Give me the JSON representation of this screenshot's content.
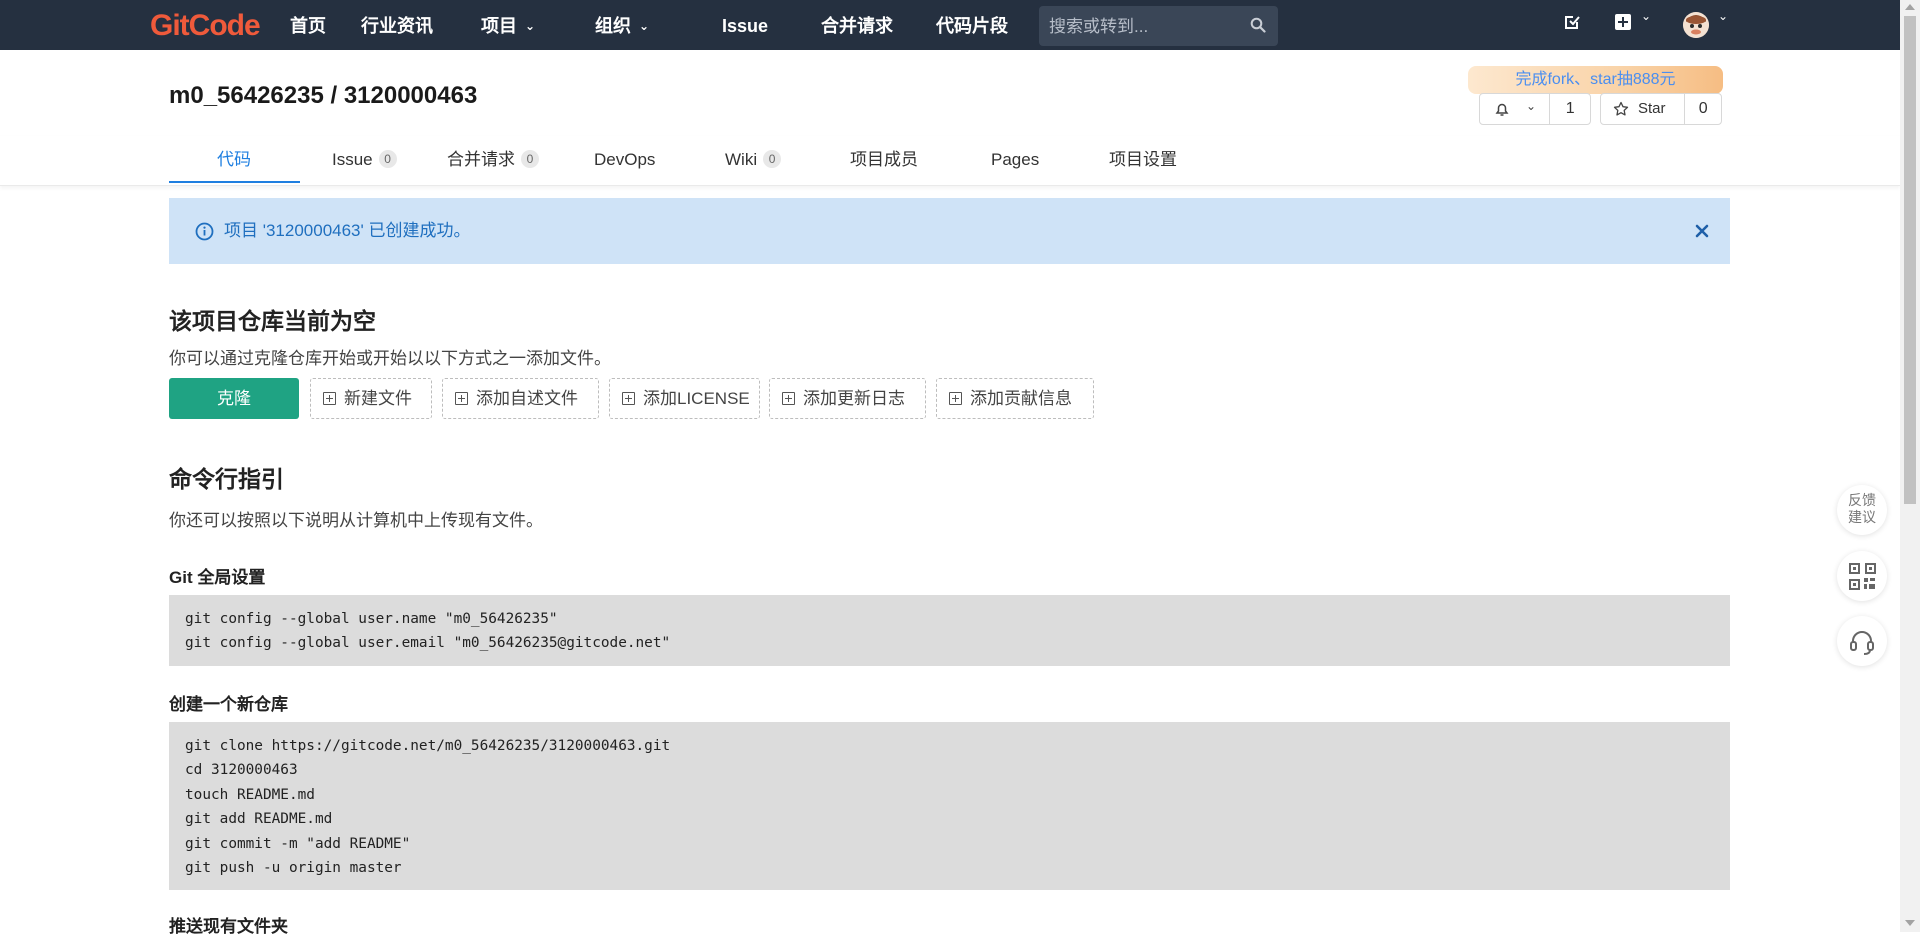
{
  "nav": {
    "logo": "GitCode",
    "items": [
      "首页",
      "行业资讯",
      "项目",
      "组织",
      "Issue",
      "合并请求",
      "代码片段"
    ],
    "search_placeholder": "搜索或转到..."
  },
  "project": {
    "title": "m0_56426235 / 3120000463",
    "promo": "完成fork、star抽888元",
    "watch_count": "1",
    "star_label": "Star",
    "star_count": "0"
  },
  "tabs": [
    {
      "label": "代码",
      "count": null
    },
    {
      "label": "Issue",
      "count": "0"
    },
    {
      "label": "合并请求",
      "count": "0"
    },
    {
      "label": "DevOps",
      "count": null
    },
    {
      "label": "Wiki",
      "count": "0"
    },
    {
      "label": "项目成员",
      "count": null
    },
    {
      "label": "Pages",
      "count": null
    },
    {
      "label": "项目设置",
      "count": null
    }
  ],
  "alert": {
    "message": "项目 '3120000463' 已创建成功。"
  },
  "empty": {
    "heading": "该项目仓库当前为空",
    "desc": "你可以通过克隆仓库开始或开始以以下方式之一添加文件。",
    "clone_label": "克隆",
    "add_buttons": [
      "新建文件",
      "添加自述文件",
      "添加LICENSE",
      "添加更新日志",
      "添加贡献信息"
    ]
  },
  "cli": {
    "heading": "命令行指引",
    "desc": "你还可以按照以下说明从计算机中上传现有文件。",
    "sections": [
      {
        "title": "Git 全局设置",
        "lines": [
          "git config --global user.name \"m0_56426235\"",
          "git config --global user.email \"m0_56426235@gitcode.net\""
        ]
      },
      {
        "title": "创建一个新仓库",
        "lines": [
          "git clone https://gitcode.net/m0_56426235/3120000463.git",
          "cd 3120000463",
          "touch README.md",
          "git add README.md",
          "git commit -m \"add README\"",
          "git push -u origin master"
        ]
      },
      {
        "title": "推送现有文件夹",
        "lines": []
      }
    ]
  },
  "float_tools": {
    "feedback_line1": "反馈",
    "feedback_line2": "建议"
  },
  "colors": {
    "nav_bg": "#253040",
    "accent": "#1f7fe0",
    "clone_button": "#1fa383",
    "alert_bg": "#cfe3f7"
  }
}
